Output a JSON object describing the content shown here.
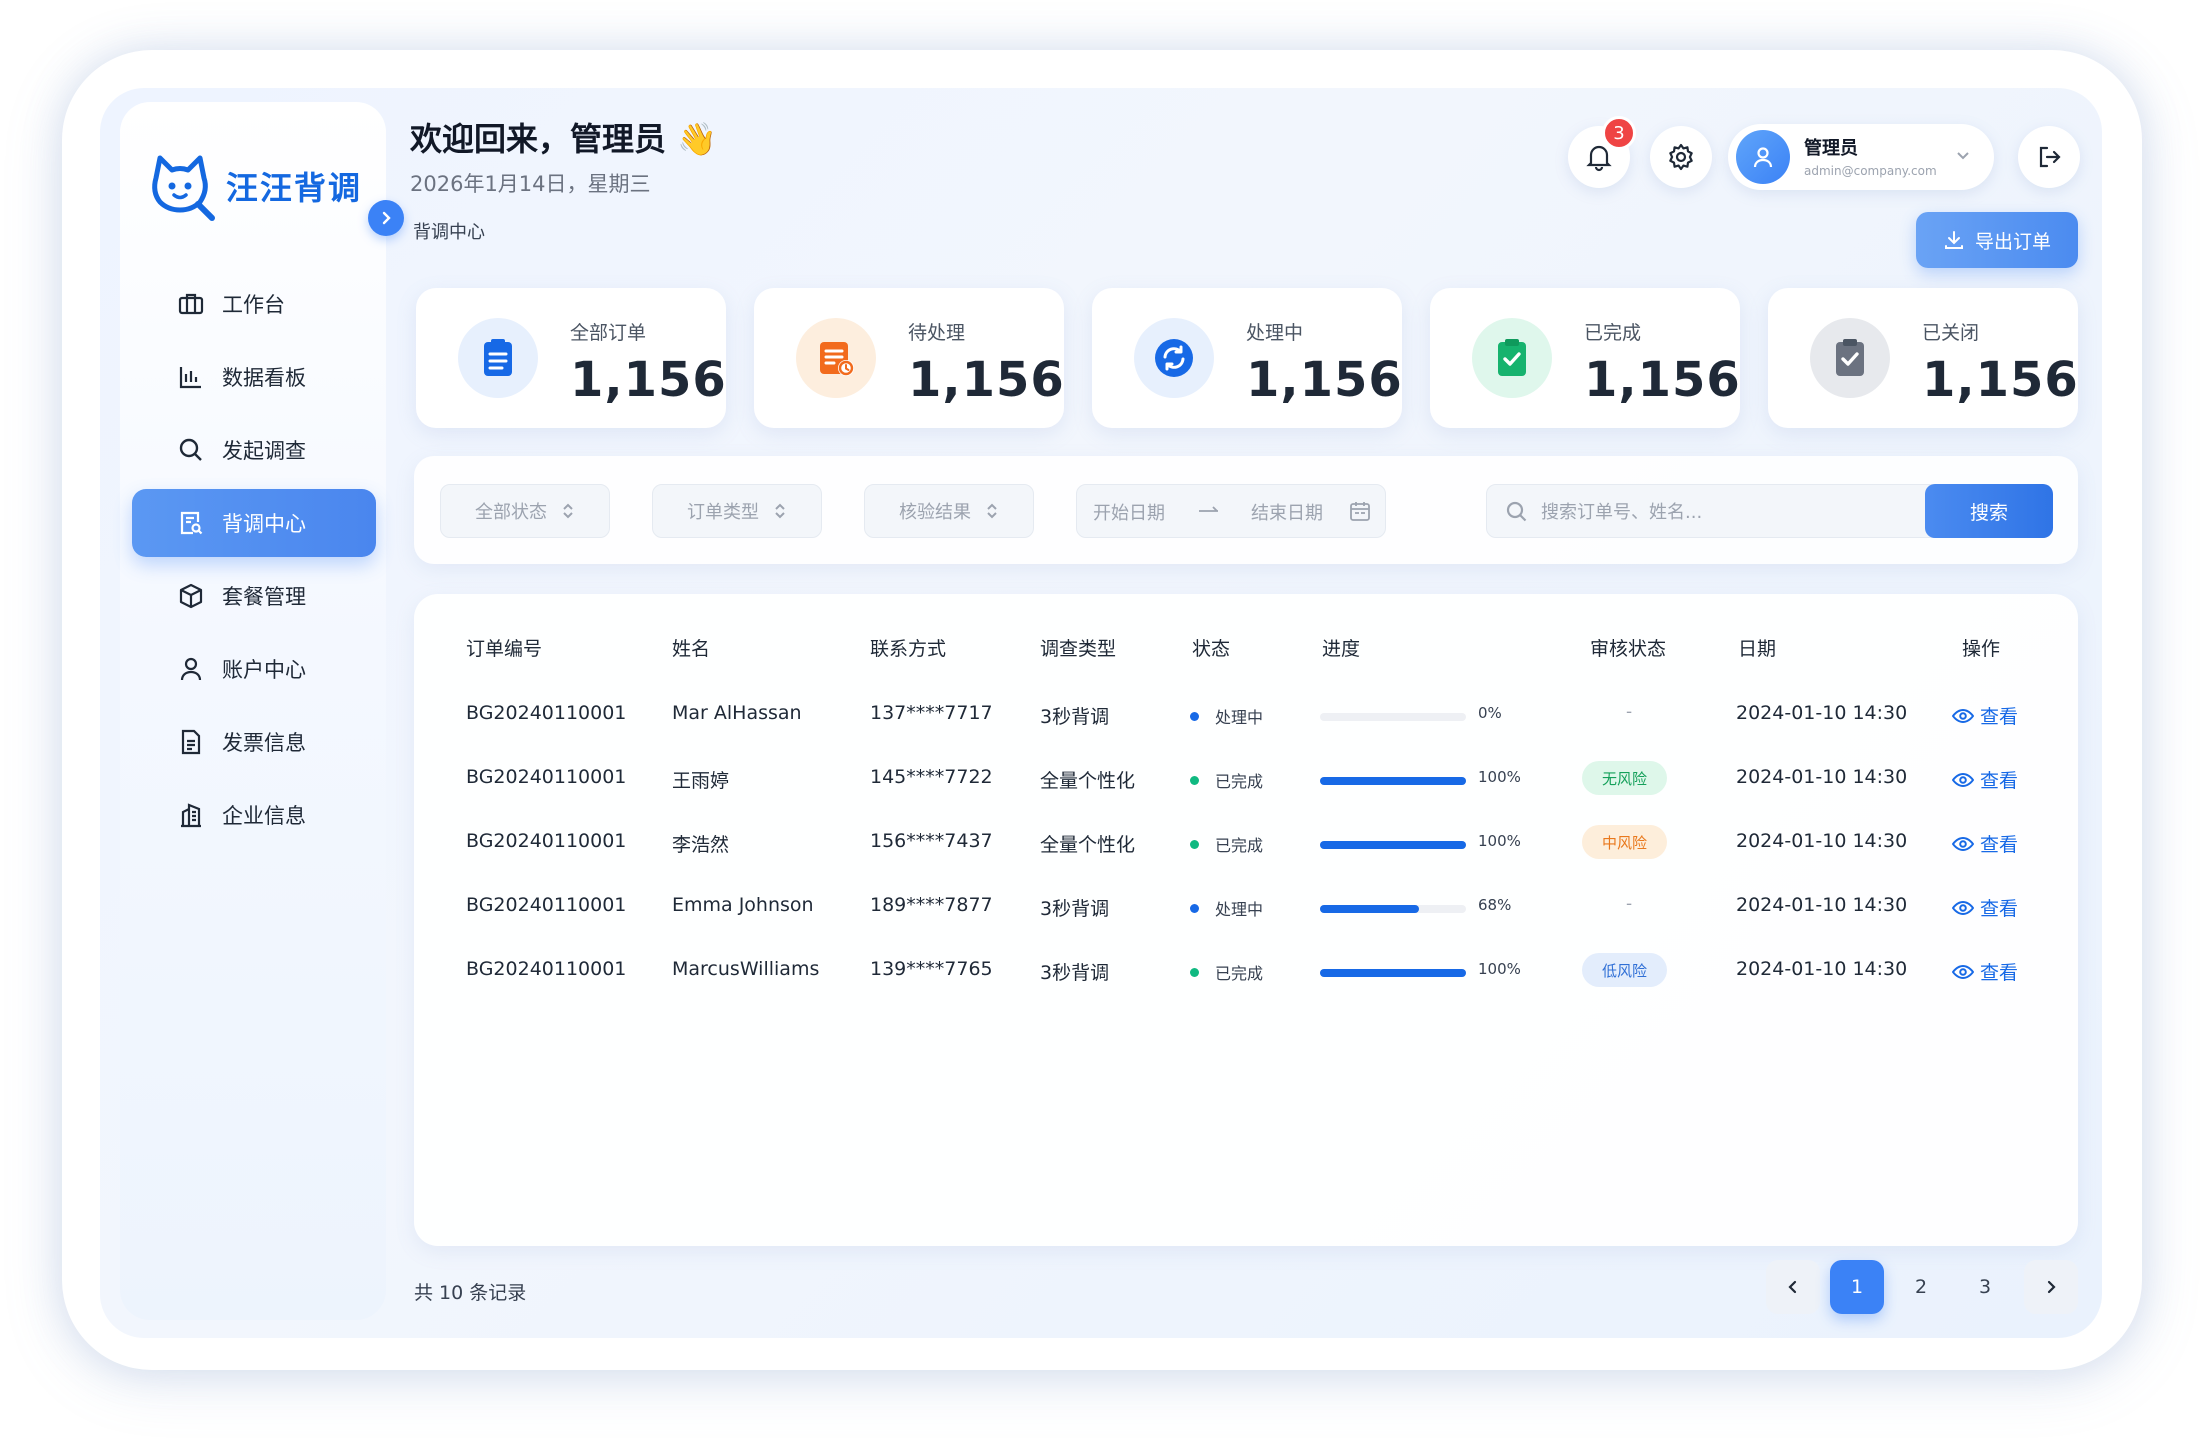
{
  "brand": {
    "name": "汪汪背调"
  },
  "colors": {
    "accent": "#3b82f6",
    "primary_text": "#1f2937",
    "success": "#10b981",
    "processing": "#1769e6",
    "danger": "#ef4444"
  },
  "sidebar": {
    "items": [
      {
        "label": "工作台",
        "icon": "briefcase-icon"
      },
      {
        "label": "数据看板",
        "icon": "bar-chart-icon"
      },
      {
        "label": "发起调查",
        "icon": "search-icon"
      },
      {
        "label": "背调中心",
        "icon": "document-search-icon",
        "active": true
      },
      {
        "label": "套餐管理",
        "icon": "package-icon"
      },
      {
        "label": "账户中心",
        "icon": "user-icon"
      },
      {
        "label": "发票信息",
        "icon": "invoice-icon"
      },
      {
        "label": "企业信息",
        "icon": "building-icon"
      }
    ]
  },
  "header": {
    "greeting": "欢迎回来，管理员",
    "wave_emoji": "👋",
    "date": "2026年1月14日，星期三",
    "breadcrumb": "背调中心",
    "notification_count": "3",
    "user": {
      "name": "管理员",
      "email": "admin@company.com"
    },
    "export_label": "导出订单"
  },
  "stats": [
    {
      "label": "全部订单",
      "value": "1,156",
      "icon": "clipboard-icon"
    },
    {
      "label": "待处理",
      "value": "1,156",
      "icon": "pending-doc-icon"
    },
    {
      "label": "处理中",
      "value": "1,156",
      "icon": "sync-icon"
    },
    {
      "label": "已完成",
      "value": "1,156",
      "icon": "clipboard-check-icon"
    },
    {
      "label": "已关闭",
      "value": "1,156",
      "icon": "clipboard-closed-icon"
    }
  ],
  "filters": {
    "status": "全部状态",
    "order_type": "订单类型",
    "verify_result": "核验结果",
    "start_date": "开始日期",
    "end_date": "结束日期",
    "search_placeholder": "搜索订单号、姓名...",
    "search_button": "搜索"
  },
  "table": {
    "headers": [
      "订单编号",
      "姓名",
      "联系方式",
      "调查类型",
      "状态",
      "进度",
      "审核状态",
      "日期",
      "操作"
    ],
    "rows": [
      {
        "id": "BG20240110001",
        "name": "Mar AlHassan",
        "phone": "137****7717",
        "type": "3秒背调",
        "status": "处理中",
        "progress": 0,
        "progress_label": "0%",
        "review": "-",
        "date": "2024-01-10 14:30",
        "action": "查看"
      },
      {
        "id": "BG20240110001",
        "name": "王雨婷",
        "phone": "145****7722",
        "type": "全量个性化",
        "status": "已完成",
        "progress": 100,
        "progress_label": "100%",
        "review": "无风险",
        "date": "2024-01-10 14:30",
        "action": "查看"
      },
      {
        "id": "BG20240110001",
        "name": "李浩然",
        "phone": "156****7437",
        "type": "全量个性化",
        "status": "已完成",
        "progress": 100,
        "progress_label": "100%",
        "review": "中风险",
        "date": "2024-01-10 14:30",
        "action": "查看"
      },
      {
        "id": "BG20240110001",
        "name": "Emma Johnson",
        "phone": "189****7877",
        "type": "3秒背调",
        "status": "处理中",
        "progress": 68,
        "progress_label": "68%",
        "review": "-",
        "date": "2024-01-10 14:30",
        "action": "查看"
      },
      {
        "id": "BG20240110001",
        "name": "MarcusWilliams",
        "phone": "139****7765",
        "type": "3秒背调",
        "status": "已完成",
        "progress": 100,
        "progress_label": "100%",
        "review": "低风险",
        "date": "2024-01-10 14:30",
        "action": "查看"
      }
    ]
  },
  "pagination": {
    "total_label": "共 10 条记录",
    "pages": [
      "1",
      "2",
      "3"
    ],
    "current": "1"
  }
}
